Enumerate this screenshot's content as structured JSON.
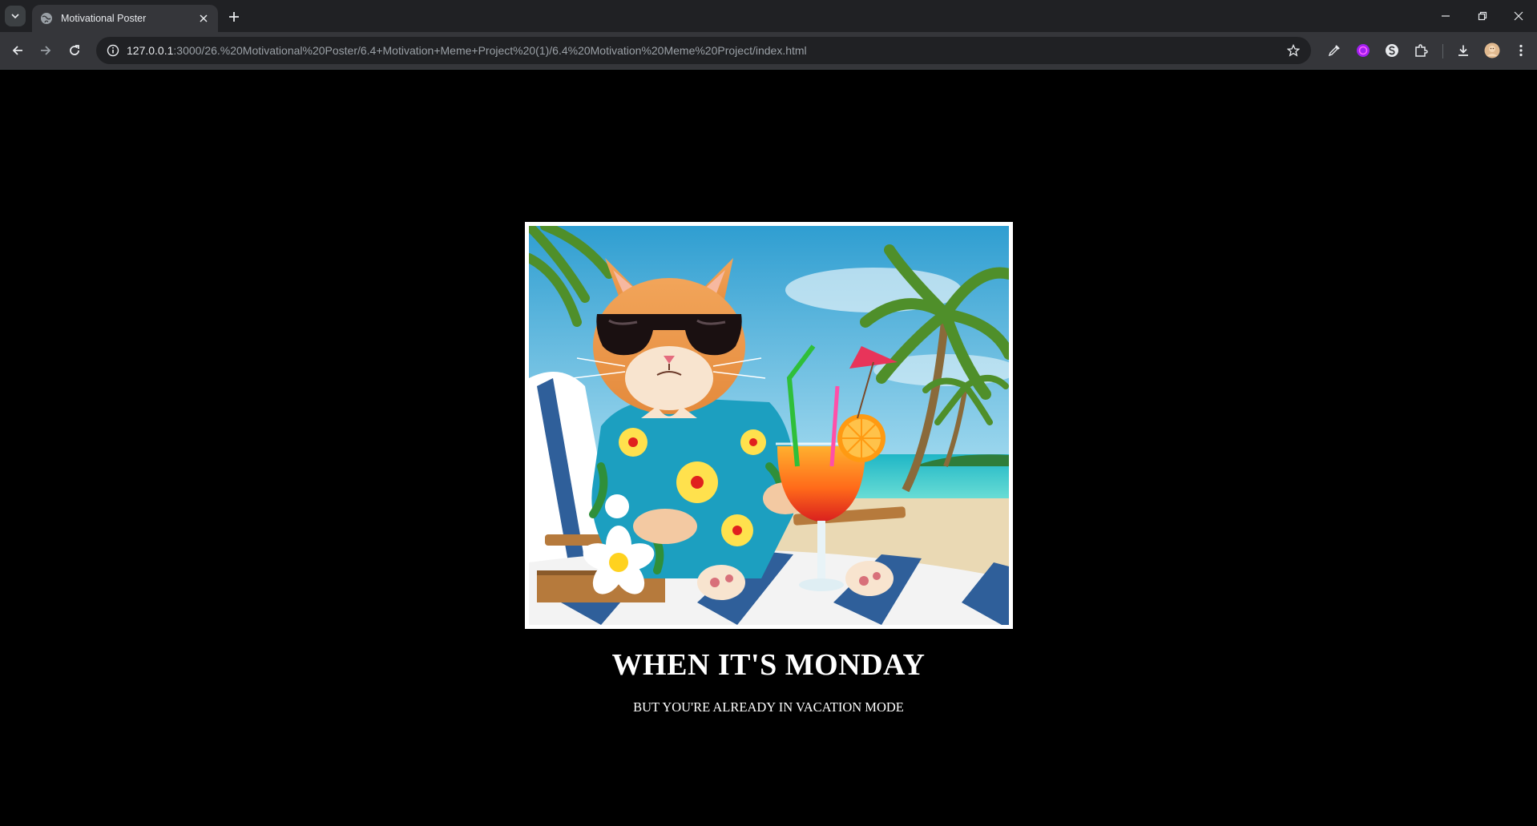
{
  "browser": {
    "tab_title": "Motivational Poster",
    "url_host": "127.0.0.1",
    "url_rest": ":3000/26.%20Motivational%20Poster/6.4+Motivation+Meme+Project%20(1)/6.4%20Motivation%20Meme%20Project/index.html",
    "icons": [
      "tab-search-icon",
      "globe-icon",
      "close-icon",
      "plus-icon",
      "minimize-icon",
      "restore-icon",
      "window-close-icon",
      "back-arrow-icon",
      "forward-arrow-icon",
      "reload-icon",
      "site-info-icon",
      "star-icon",
      "eyedropper-icon",
      "color-wheel-icon",
      "s-extension-icon",
      "puzzle-icon",
      "download-icon",
      "profile-avatar",
      "more-menu-icon"
    ]
  },
  "poster": {
    "image_alt": "Orange cat in sunglasses and Hawaiian shirt lounging on a beach chair holding a tropical cocktail",
    "headline": "WHEN IT'S MONDAY",
    "subline": "BUT YOU'RE ALREADY IN VACATION MODE"
  },
  "colors": {
    "page_background": "#000000",
    "text": "#ffffff",
    "frame": "#ffffff",
    "chrome_dark": "#202124",
    "chrome_toolbar": "#35363a"
  }
}
